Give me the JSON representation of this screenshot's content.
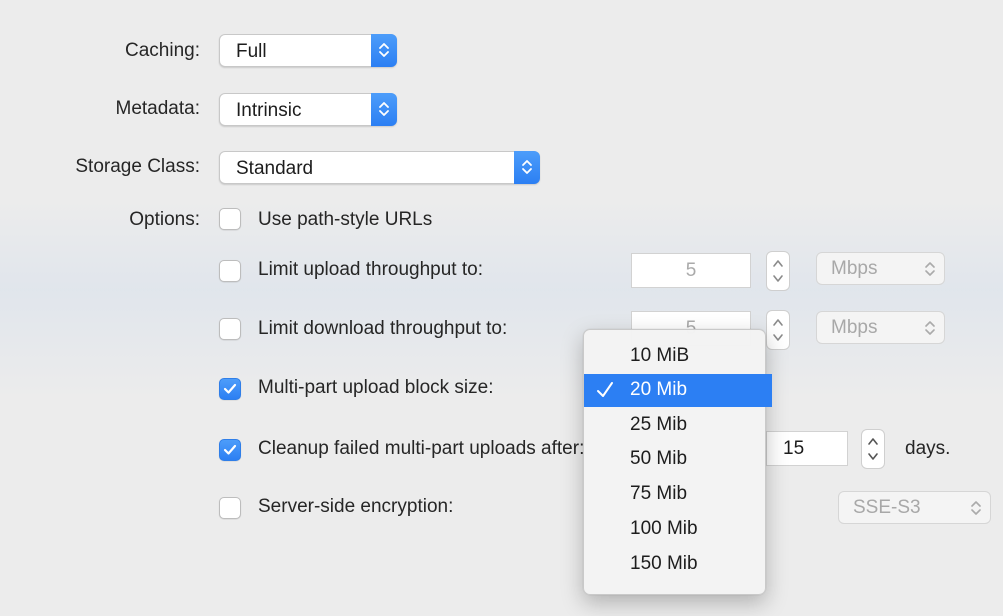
{
  "form": {
    "caching": {
      "label": "Caching:",
      "value": "Full"
    },
    "metadata": {
      "label": "Metadata:",
      "value": "Intrinsic"
    },
    "storage_class": {
      "label": "Storage Class:",
      "value": "Standard"
    },
    "options_label": "Options:"
  },
  "options": {
    "path_style": {
      "label": "Use path-style URLs",
      "checked": false
    },
    "limit_upload": {
      "label": "Limit upload throughput to:",
      "checked": false,
      "value": "5",
      "unit": "Mbps"
    },
    "limit_download": {
      "label": "Limit download throughput to:",
      "checked": false,
      "value": "5",
      "unit": "Mbps"
    },
    "multipart": {
      "label": "Multi-part upload block size:",
      "checked": true
    },
    "cleanup": {
      "label": "Cleanup failed multi-part uploads after:",
      "checked": true,
      "value": "15",
      "suffix": "days."
    },
    "encryption": {
      "label": "Server-side encryption:",
      "checked": false,
      "value": "SSE-S3"
    }
  },
  "dropdown": {
    "items": [
      "10 MiB",
      "20 Mib",
      "25 Mib",
      "50 Mib",
      "75 Mib",
      "100 Mib",
      "150 Mib"
    ],
    "selected_index": 1
  },
  "colors": {
    "accent": "#2c7ff3",
    "background": "#ececec"
  }
}
